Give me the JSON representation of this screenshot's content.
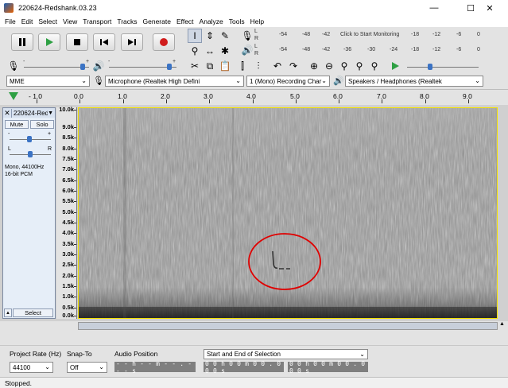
{
  "window": {
    "title": "220624-Redshank.03.23",
    "minimize": "—",
    "maximize": "☐",
    "close": "✕"
  },
  "menu": [
    "File",
    "Edit",
    "Select",
    "View",
    "Transport",
    "Tracks",
    "Generate",
    "Effect",
    "Analyze",
    "Tools",
    "Help"
  ],
  "meters": {
    "record_scale": [
      "-54",
      "-48",
      "-42",
      "Click to Start Monitoring",
      "-18",
      "-12",
      "-6",
      "0"
    ],
    "playback_scale": [
      "-54",
      "-48",
      "-42",
      "-36",
      "-30",
      "-24",
      "-18",
      "-12",
      "-6",
      "0"
    ],
    "left": "L",
    "right": "R"
  },
  "mixer": {
    "minus": "-",
    "plus": "+"
  },
  "devices": {
    "host": "MME",
    "mic": "Microphone (Realtek High Defini",
    "channels": "1 (Mono) Recording Char",
    "speaker": "Speakers / Headphones (Realtek"
  },
  "ruler": {
    "labels": [
      "- 1.0",
      "0.0",
      "1.0",
      "2.0",
      "3.0",
      "4.0",
      "5.0",
      "6.0",
      "7.0",
      "8.0",
      "9.0"
    ]
  },
  "track": {
    "name": "220624-Red",
    "close": "✕",
    "mute": "Mute",
    "solo": "Solo",
    "pan_left": "L",
    "pan_right": "R",
    "gain_minus": "-",
    "gain_plus": "+",
    "info_line1": "Mono, 44100Hz",
    "info_line2": "16-bit PCM",
    "select": "Select",
    "collapse": "▲"
  },
  "freq_axis": [
    "10.0k",
    "9.0k",
    "8.5k",
    "8.0k",
    "7.5k",
    "7.0k",
    "6.5k",
    "6.0k",
    "5.5k",
    "5.0k",
    "4.5k",
    "4.0k",
    "3.5k",
    "3.0k",
    "2.5k",
    "2.0k",
    "1.5k",
    "1.0k",
    "0.5k",
    "0.0k"
  ],
  "selection_bar": {
    "rate_label": "Project Rate (Hz)",
    "rate_value": "44100",
    "snap_label": "Snap-To",
    "snap_value": "Off",
    "position_label": "Audio Position",
    "position_value": "- - h - - m - - . - - - s",
    "range_label": "Start and End of Selection",
    "start_value": "0 0 h 0 0 m 0 0 . 0 0 0 s",
    "end_value": "0 0 h 0 0 m 0 0 . 0 0 0 s"
  },
  "status": "Stopped.",
  "colors": {
    "annotation": "#e00000",
    "track_border": "#f2e000",
    "spectro_bg": "#8c8c8c"
  }
}
